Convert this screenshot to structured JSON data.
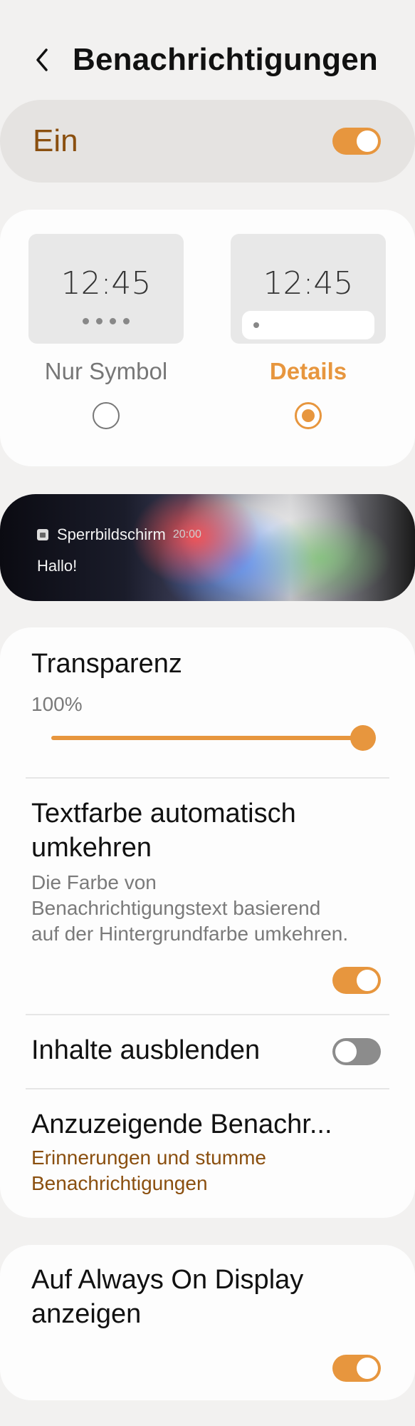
{
  "header": {
    "title": "Benachrichtigungen",
    "back_icon": "chevron-left-icon"
  },
  "master": {
    "label": "Ein",
    "enabled": true
  },
  "style_chooser": {
    "options": [
      {
        "label": "Nur Symbol",
        "time": "12:45",
        "selected": false
      },
      {
        "label": "Details",
        "time": "12:45",
        "selected": true
      }
    ]
  },
  "preview": {
    "app_name": "Sperrbildschirm",
    "time": "20:00",
    "message": "Hallo!"
  },
  "settings": {
    "transparency": {
      "title": "Transparenz",
      "value_text": "100%",
      "value": 1.0
    },
    "invert_text": {
      "title_line1": "Textfarbe automatisch",
      "title_line2": "umkehren",
      "desc_line1": "Die Farbe von",
      "desc_line2": "Benachrichtigungstext basierend",
      "desc_line3": "auf der Hintergrundfarbe umkehren.",
      "enabled": true
    },
    "hide_content": {
      "title": "Inhalte ausblenden",
      "enabled": false
    },
    "shown_notifications": {
      "title": "Anzuzeigende Benachr...",
      "value_line1": "Erinnerungen und stumme",
      "value_line2": "Benachrichtigungen"
    }
  },
  "aod": {
    "title_line1": "Auf Always On Display",
    "title_line2": "anzeigen",
    "enabled": true
  },
  "colors": {
    "accent": "#e7963e",
    "accent_dark": "#8a4f0f",
    "background": "#f2f1f0",
    "card": "#fdfdfd"
  }
}
